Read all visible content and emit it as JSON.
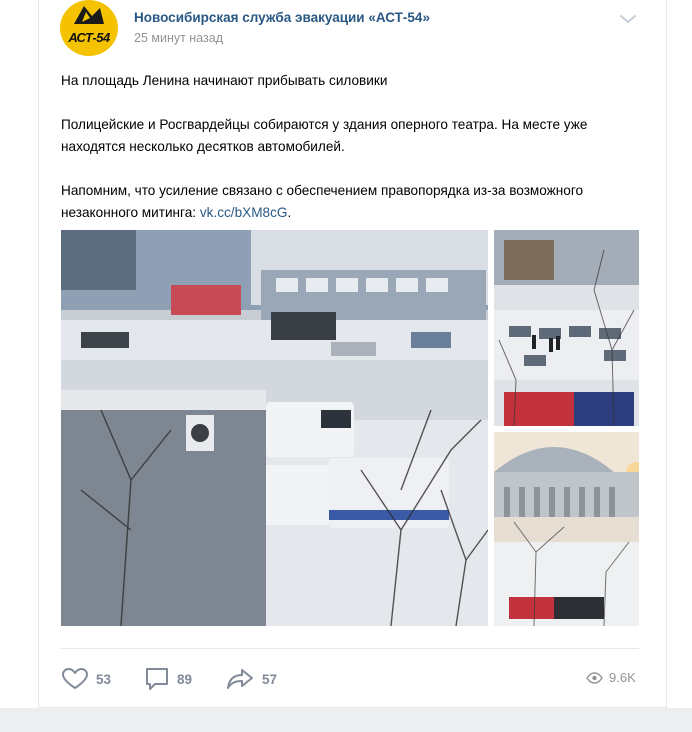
{
  "post": {
    "author": "Новосибирская служба эвакуации «АСТ-54»",
    "time": "25 минут назад",
    "avatar_text": "АСТ-54",
    "paragraphs": {
      "p1": "На площадь Ленина начинают прибывать силовики",
      "p2": "Полицейские и Росгвардейцы собираются у здания оперного театра. На месте уже находятся несколько десятков автомобилей.",
      "p3_text": "Напомним, что усиление связано с обеспечением правопорядка из-за возможного незаконного митинга: ",
      "p3_link": "vk.cc/bXM8cG",
      "p3_end": "."
    },
    "photos": [
      {
        "icon": "photo-street-vans"
      },
      {
        "icon": "photo-square-cars"
      },
      {
        "icon": "photo-opera-theatre"
      }
    ]
  },
  "footer": {
    "likes": "53",
    "comments": "89",
    "shares": "57",
    "views": "9.6K"
  },
  "colors": {
    "link": "#2a5885",
    "meta": "#939393",
    "action": "#828a99",
    "avatar": "#f5c200"
  }
}
